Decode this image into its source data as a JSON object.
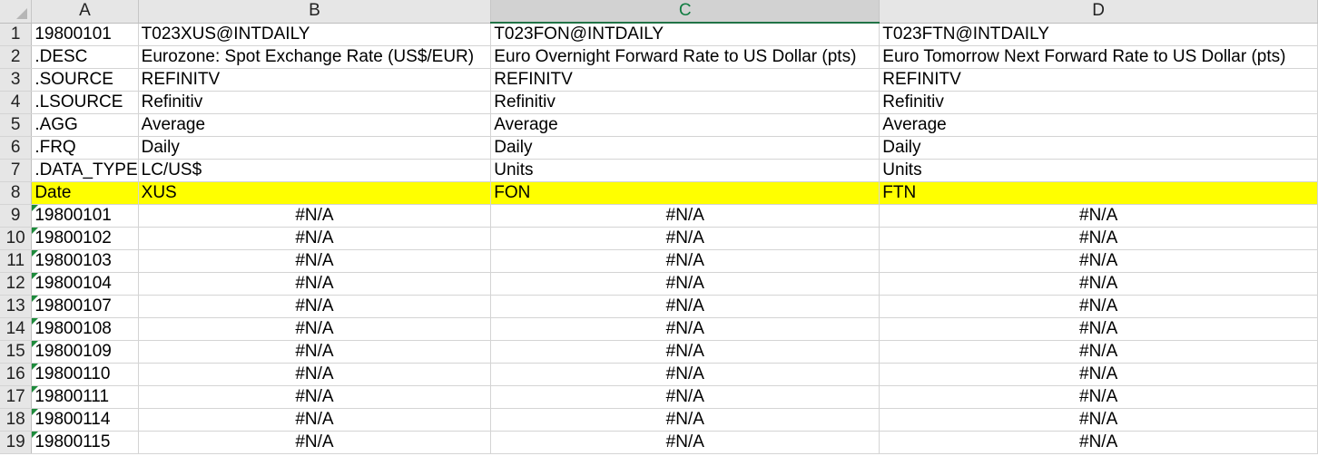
{
  "columns": [
    "A",
    "B",
    "C",
    "D"
  ],
  "active_column": "C",
  "rows": [
    {
      "num": "1",
      "cells": [
        "19800101",
        "T023XUS@INTDAILY",
        "T023FON@INTDAILY",
        "T023FTN@INTDAILY"
      ]
    },
    {
      "num": "2",
      "cells": [
        ".DESC",
        "Eurozone: Spot Exchange Rate (US$/EUR)",
        "Euro Overnight Forward Rate to US Dollar (pts)",
        "Euro Tomorrow Next Forward Rate to US Dollar (pts)"
      ]
    },
    {
      "num": "3",
      "cells": [
        ".SOURCE",
        "REFINITV",
        "REFINITV",
        "REFINITV"
      ]
    },
    {
      "num": "4",
      "cells": [
        ".LSOURCE",
        "Refinitiv",
        "Refinitiv",
        "Refinitiv"
      ]
    },
    {
      "num": "5",
      "cells": [
        ".AGG",
        "Average",
        "Average",
        "Average"
      ]
    },
    {
      "num": "6",
      "cells": [
        ".FRQ",
        "Daily",
        "Daily",
        "Daily"
      ]
    },
    {
      "num": "7",
      "cells": [
        ".DATA_TYPE",
        "LC/US$",
        "Units",
        "Units"
      ]
    },
    {
      "num": "8",
      "cells": [
        "Date",
        "XUS",
        "FON",
        "FTN"
      ],
      "highlight": true
    },
    {
      "num": "9",
      "cells": [
        "19800101",
        "#N/A",
        "#N/A",
        "#N/A"
      ],
      "data": true
    },
    {
      "num": "10",
      "cells": [
        "19800102",
        "#N/A",
        "#N/A",
        "#N/A"
      ],
      "data": true
    },
    {
      "num": "11",
      "cells": [
        "19800103",
        "#N/A",
        "#N/A",
        "#N/A"
      ],
      "data": true
    },
    {
      "num": "12",
      "cells": [
        "19800104",
        "#N/A",
        "#N/A",
        "#N/A"
      ],
      "data": true
    },
    {
      "num": "13",
      "cells": [
        "19800107",
        "#N/A",
        "#N/A",
        "#N/A"
      ],
      "data": true
    },
    {
      "num": "14",
      "cells": [
        "19800108",
        "#N/A",
        "#N/A",
        "#N/A"
      ],
      "data": true
    },
    {
      "num": "15",
      "cells": [
        "19800109",
        "#N/A",
        "#N/A",
        "#N/A"
      ],
      "data": true
    },
    {
      "num": "16",
      "cells": [
        "19800110",
        "#N/A",
        "#N/A",
        "#N/A"
      ],
      "data": true
    },
    {
      "num": "17",
      "cells": [
        "19800111",
        "#N/A",
        "#N/A",
        "#N/A"
      ],
      "data": true
    },
    {
      "num": "18",
      "cells": [
        "19800114",
        "#N/A",
        "#N/A",
        "#N/A"
      ],
      "data": true
    },
    {
      "num": "19",
      "cells": [
        "19800115",
        "#N/A",
        "#N/A",
        "#N/A"
      ],
      "data": true
    }
  ],
  "colors": {
    "highlight_fill": "#ffff00",
    "active_header_text": "#107c41",
    "error_flag": "#1e8b3c"
  }
}
